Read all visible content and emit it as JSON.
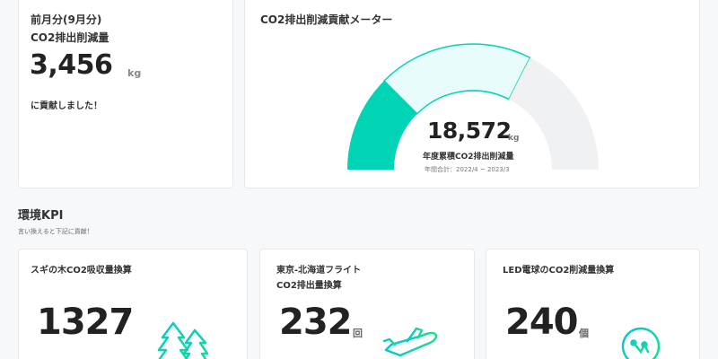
{
  "monthly": {
    "period": "前月分(9月分)",
    "label": "CO2排出削減量",
    "value": "3,456",
    "unit": "kg",
    "note": "に貢献しました！"
  },
  "meter": {
    "title": "CO2排出削減貢献メーター",
    "value": "18,572",
    "unit": "kg",
    "label": "年度累積CO2排出削減量",
    "period": "年間合計：2022/4 ~ 2023/3",
    "segments": [
      {
        "name": "achieved",
        "fraction": 0.25,
        "color": "#00d4b4"
      },
      {
        "name": "target",
        "fraction": 0.4,
        "color": "#e8fdfb"
      },
      {
        "name": "remaining",
        "fraction": 0.35,
        "color": "#f0f1f3"
      }
    ]
  },
  "kpi_section": {
    "title": "環境KPI",
    "subtitle": "言い換えると下記に貢献！"
  },
  "kpis": [
    {
      "title_line1": "スギの木CO2吸収量換算",
      "title_line2": "",
      "value": "1327",
      "unit": "",
      "icon": "tree-icon"
    },
    {
      "title_line1": "東京-北海道フライト",
      "title_line2": "CO2排出量換算",
      "value": "232",
      "unit": "回",
      "icon": "airplane-icon"
    },
    {
      "title_line1": "LED電球のCO2削減量換算",
      "title_line2": "",
      "value": "240",
      "unit": "個",
      "icon": "light-bulb-icon"
    }
  ],
  "colors": {
    "accent": "#00d4b4",
    "accent_light": "#e8fdfb",
    "gauge_gray": "#f0f1f3",
    "icon_gradient_start": "#00c8d4",
    "icon_gradient_end": "#22dd88"
  }
}
